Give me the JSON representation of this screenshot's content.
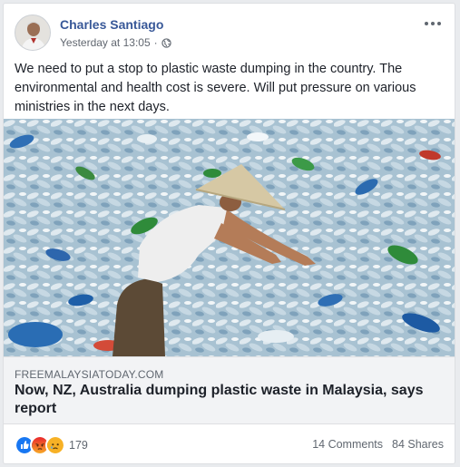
{
  "post": {
    "author": "Charles Santiago",
    "timestamp": "Yesterday at 13:05",
    "separator": "·",
    "privacy_icon": "globe-icon",
    "text": "We need to put a stop to plastic waste dumping in the country. The environmental and health cost is severe. Will put pressure on various ministries in the next days."
  },
  "link": {
    "domain": "FREEMALAYSIATODAY.COM",
    "headline": "Now, NZ, Australia dumping plastic waste in Malaysia, says report"
  },
  "engagement": {
    "reaction_icons": [
      "like-icon",
      "angry-icon",
      "sad-icon"
    ],
    "reaction_count": "179",
    "comments": "14 Comments",
    "shares": "84 Shares"
  },
  "colors": {
    "author_link": "#385898",
    "like": "#1877f2",
    "angry": "#e9710f",
    "sad": "#f7b125"
  }
}
